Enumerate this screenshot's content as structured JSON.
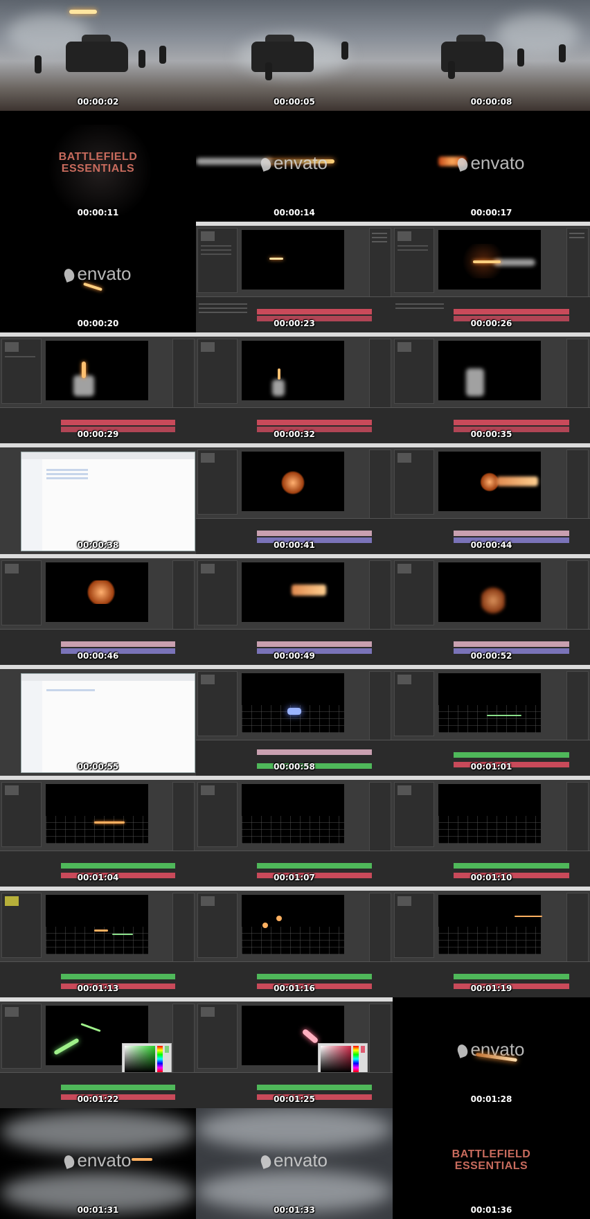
{
  "brand": {
    "title_line1": "BATTLEFIELD",
    "title_line2": "ESSENTIALS",
    "watermark": "envato"
  },
  "colors": {
    "title_red": "#c86b5d",
    "tracer_orange": "#ff9a3c",
    "track_red": "#c94a5a",
    "track_purple": "#7a73b8",
    "track_green": "#4fb85a",
    "ae_panel": "#3b3b3b"
  },
  "frames": [
    {
      "time": "00:00:02",
      "scene": "snow-battle"
    },
    {
      "time": "00:00:05",
      "scene": "snow-battle"
    },
    {
      "time": "00:00:08",
      "scene": "snow-battle"
    },
    {
      "time": "00:00:11",
      "scene": "title-card"
    },
    {
      "time": "00:00:14",
      "scene": "envato-tracer"
    },
    {
      "time": "00:00:17",
      "scene": "envato-tracer"
    },
    {
      "time": "00:00:20",
      "scene": "envato-tracer"
    },
    {
      "time": "00:00:23",
      "scene": "after-effects"
    },
    {
      "time": "00:00:26",
      "scene": "after-effects"
    },
    {
      "time": "00:00:29",
      "scene": "after-effects"
    },
    {
      "time": "00:00:32",
      "scene": "after-effects"
    },
    {
      "time": "00:00:35",
      "scene": "after-effects"
    },
    {
      "time": "00:00:38",
      "scene": "file-explorer"
    },
    {
      "time": "00:00:41",
      "scene": "after-effects"
    },
    {
      "time": "00:00:44",
      "scene": "after-effects"
    },
    {
      "time": "00:00:46",
      "scene": "after-effects"
    },
    {
      "time": "00:00:49",
      "scene": "after-effects"
    },
    {
      "time": "00:00:52",
      "scene": "after-effects"
    },
    {
      "time": "00:00:55",
      "scene": "file-explorer"
    },
    {
      "time": "00:00:58",
      "scene": "after-effects"
    },
    {
      "time": "00:01:01",
      "scene": "after-effects"
    },
    {
      "time": "00:01:04",
      "scene": "after-effects"
    },
    {
      "time": "00:01:07",
      "scene": "after-effects"
    },
    {
      "time": "00:01:10",
      "scene": "after-effects"
    },
    {
      "time": "00:01:13",
      "scene": "after-effects"
    },
    {
      "time": "00:01:16",
      "scene": "after-effects"
    },
    {
      "time": "00:01:19",
      "scene": "after-effects"
    },
    {
      "time": "00:01:22",
      "scene": "after-effects"
    },
    {
      "time": "00:01:25",
      "scene": "after-effects"
    },
    {
      "time": "00:01:28",
      "scene": "envato-tracer"
    },
    {
      "time": "00:01:31",
      "scene": "envato-smoke"
    },
    {
      "time": "00:01:33",
      "scene": "envato-smoke"
    },
    {
      "time": "00:01:36",
      "scene": "title-card"
    }
  ]
}
